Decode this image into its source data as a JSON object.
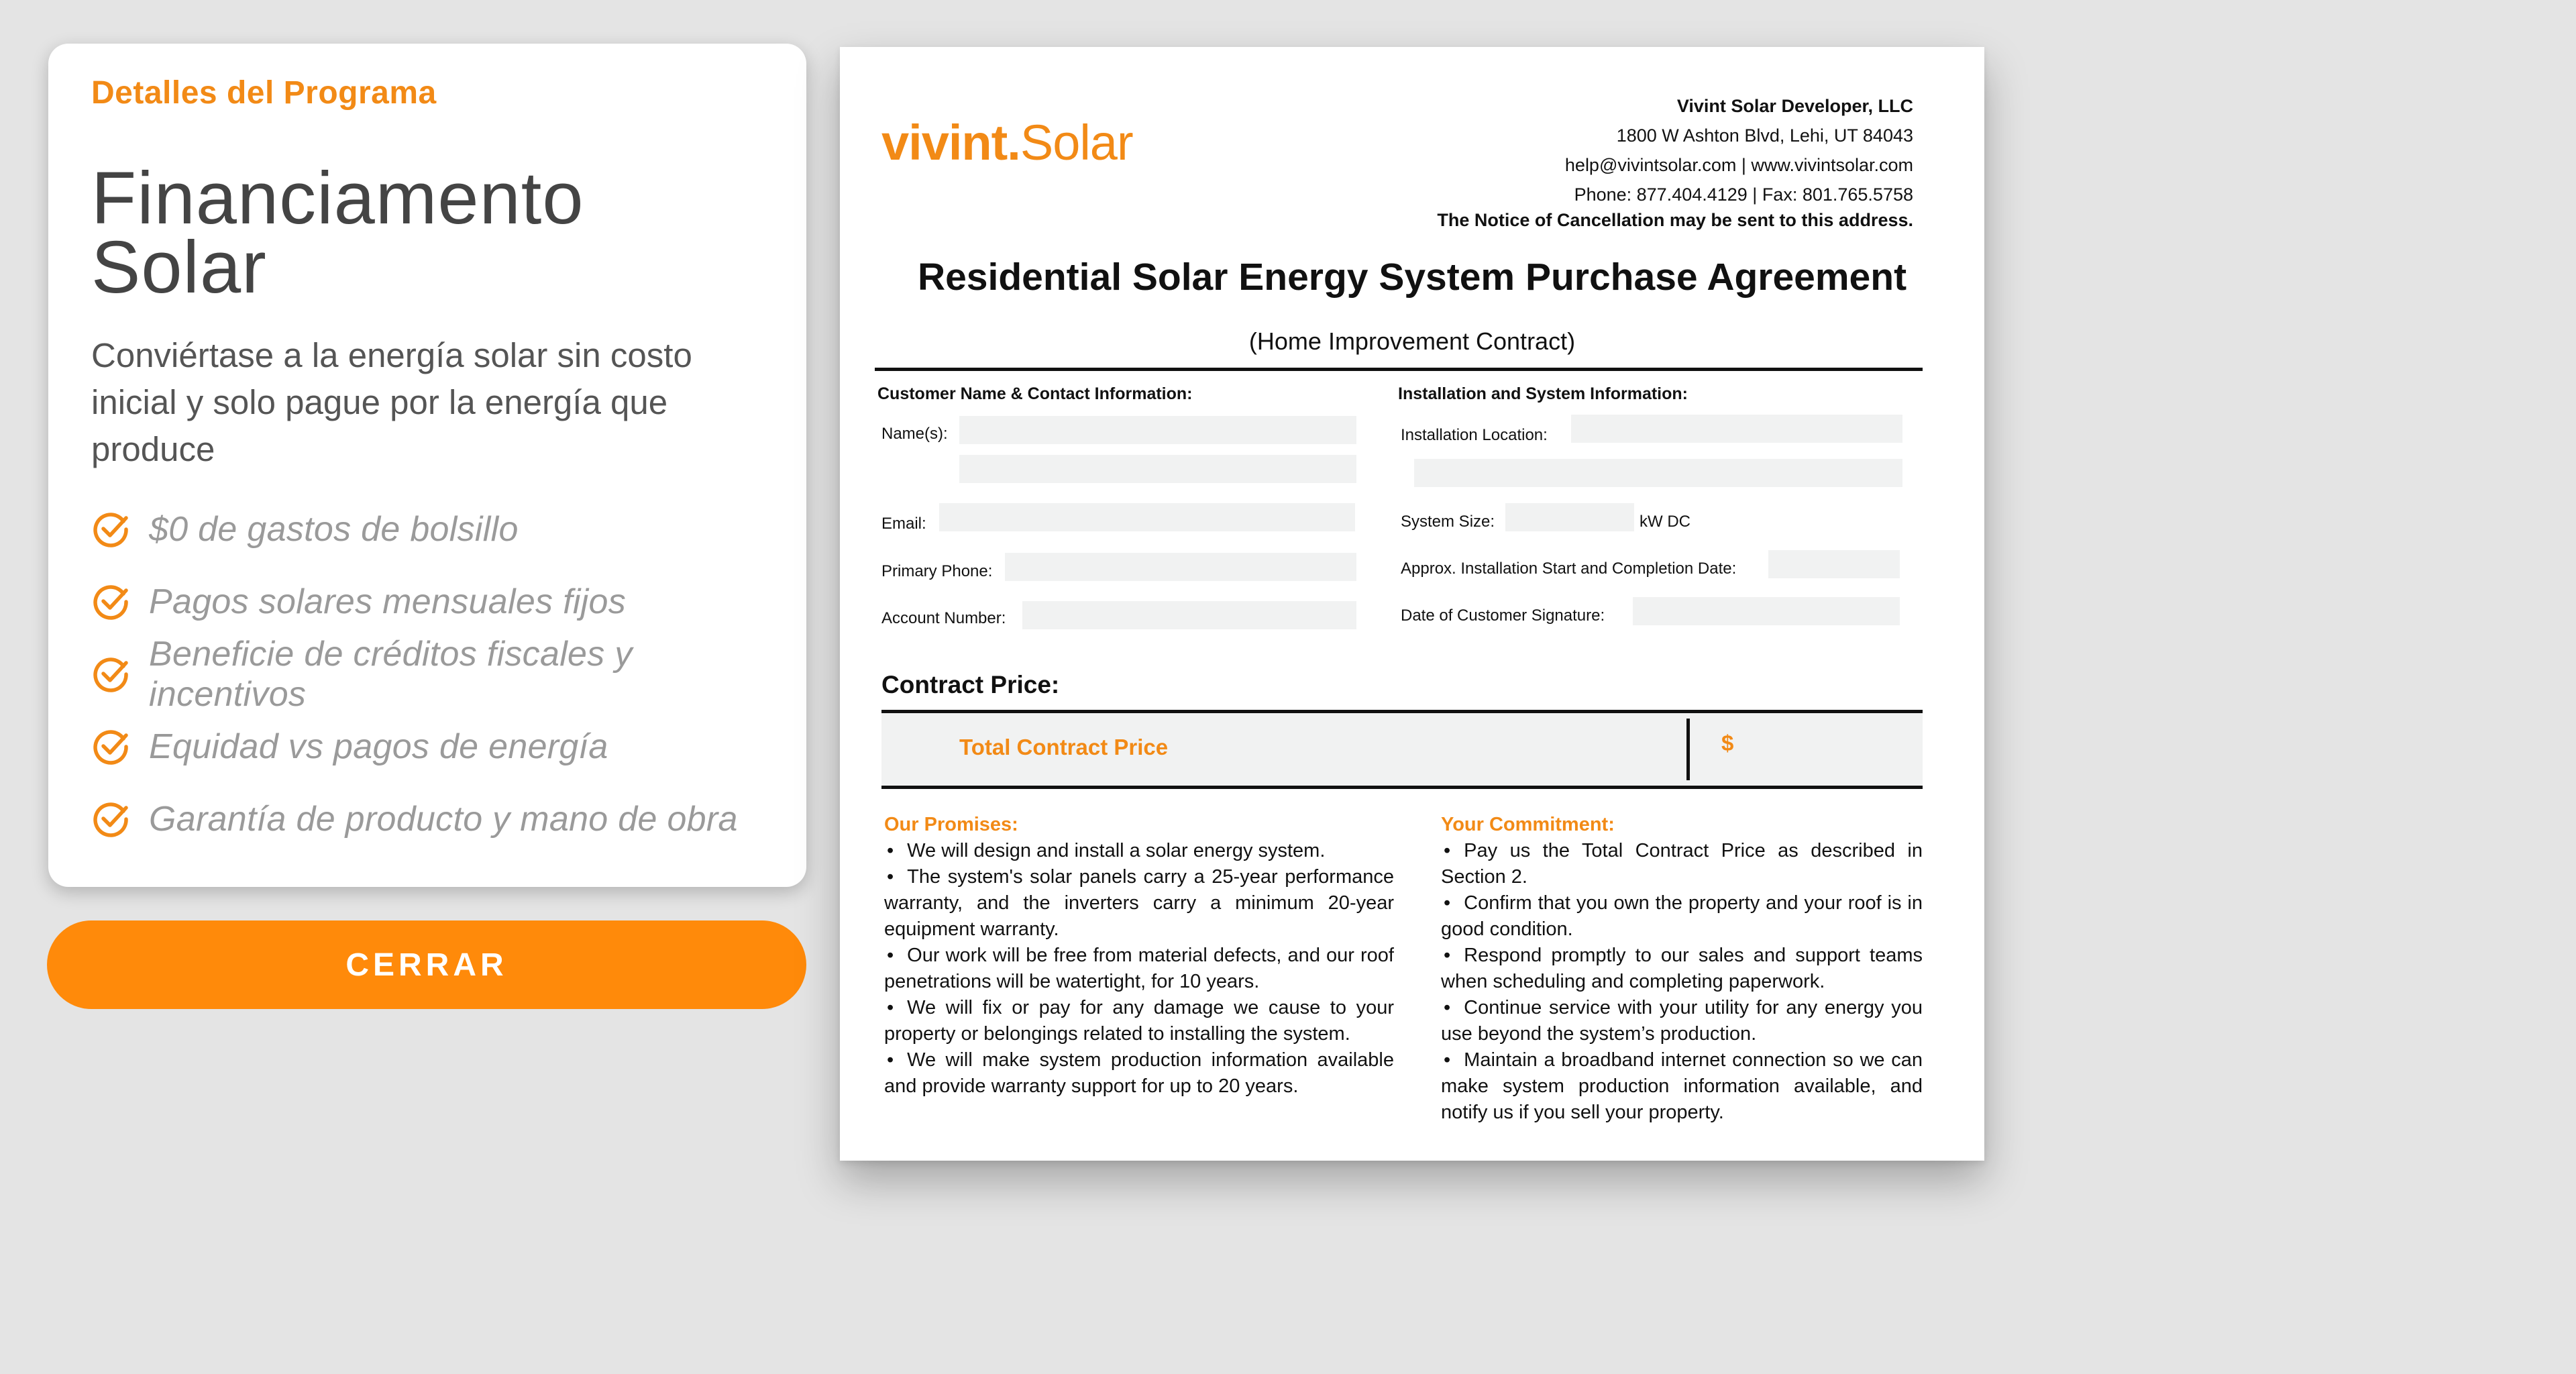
{
  "program": {
    "eyebrow": "Detalles del Programa",
    "title": "Financiamento Solar",
    "description": "Conviértase a la energía solar sin costo inicial y solo pague por la energía que produce",
    "benefits": [
      "$0 de gastos de bolsillo",
      "Pagos solares mensuales fijos",
      "Beneficie de créditos fiscales y incentivos",
      "Equidad vs pagos de energía",
      "Garantía de producto y mano de obra"
    ],
    "icon": "check-circle-icon",
    "accent_color": "#f28a16"
  },
  "close_button": {
    "label": "CERRAR",
    "color": "#ff8a0a"
  },
  "document": {
    "logo": {
      "word1": "vivint",
      "dot": ".",
      "word2": "Solar"
    },
    "company": {
      "name": "Vivint Solar Developer, LLC",
      "address": "1800 W Ashton Blvd, Lehi, UT 84043",
      "web": "help@vivintsolar.com | www.vivintsolar.com",
      "phone": "Phone: 877.404.4129 | Fax: 801.765.5758",
      "notice": "The Notice of Cancellation may be sent to this address."
    },
    "title": "Residential Solar Energy System Purchase Agreement",
    "subtitle": "(Home Improvement Contract)",
    "customer_section": {
      "heading": "Customer Name & Contact Information:",
      "names_label": "Name(s):",
      "email_label": "Email:",
      "phone_label": "Primary Phone:",
      "account_label": "Account Number:"
    },
    "install_section": {
      "heading": "Installation and System Information:",
      "location_label": "Installation Location:",
      "size_label": "System Size:",
      "size_unit": "kW DC",
      "dates_label": "Approx. Installation Start and Completion Date:",
      "signature_date_label": "Date of Customer Signature:"
    },
    "contract_price": {
      "heading": "Contract Price:",
      "total_label": "Total Contract Price",
      "currency": "$"
    },
    "promises": {
      "heading": "Our Promises:",
      "items": [
        "We will design and install a solar energy system.",
        "The system's solar panels carry a 25-year performance warranty, and the inverters carry a minimum 20-year equipment warranty.",
        "Our work will be free from material defects, and our roof penetrations will be watertight, for 10 years.",
        "We will fix or pay for any damage we cause to your property or belongings related to installing the system.",
        "We will make system production information available and provide warranty support for up to 20 years."
      ]
    },
    "commitment": {
      "heading": "Your Commitment:",
      "items": [
        "Pay us the Total Contract Price as described in Section 2.",
        "Confirm that you own the property and your roof is in good condition.",
        "Respond promptly to our sales and support teams when scheduling and completing paperwork.",
        "Continue service with your utility for any energy you use beyond the system’s production.",
        "Maintain a broadband internet connection so we can make system production information available, and notify us if you sell your property."
      ]
    }
  }
}
